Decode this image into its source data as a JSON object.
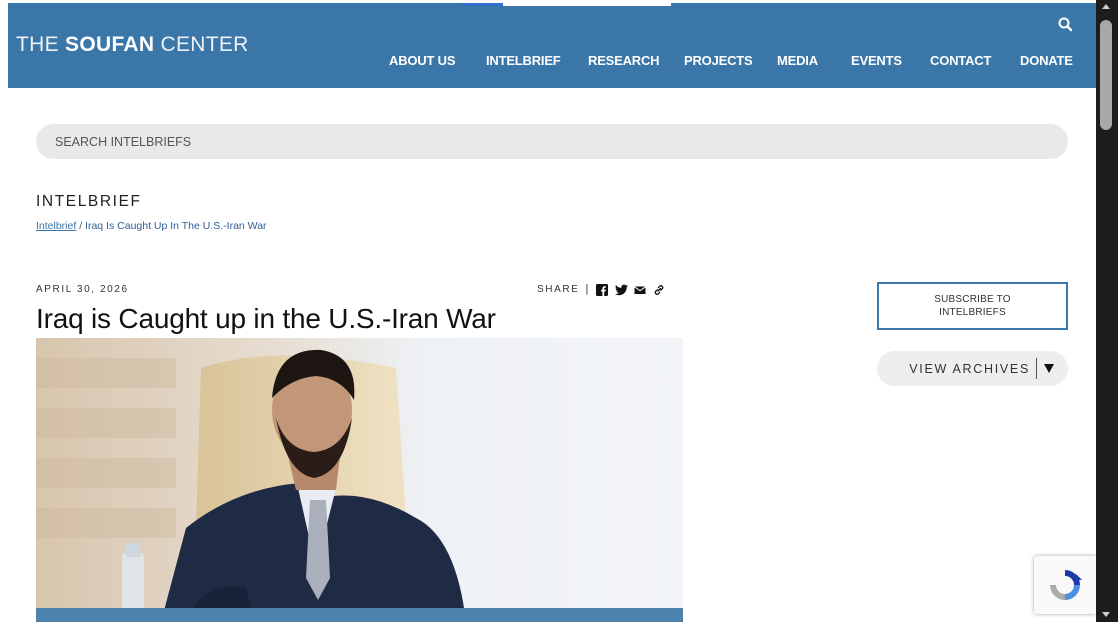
{
  "header": {
    "logo": {
      "part1": "THE ",
      "part2": "SOUFAN",
      "part3": " CENTER"
    },
    "nav": [
      {
        "label": "ABOUT US"
      },
      {
        "label": "INTELBRIEF"
      },
      {
        "label": "RESEARCH"
      },
      {
        "label": "PROJECTS"
      },
      {
        "label": "MEDIA"
      },
      {
        "label": "EVENTS"
      },
      {
        "label": "CONTACT"
      },
      {
        "label": "DONATE"
      }
    ],
    "search_icon": "search-icon"
  },
  "search": {
    "placeholder": "SEARCH INTELBRIEFS"
  },
  "section": {
    "label": "INTELBRIEF",
    "breadcrumb": {
      "link": "Intelbrief",
      "separator": " / ",
      "current": "Iraq Is Caught Up In The U.S.-Iran War"
    }
  },
  "article": {
    "date": "APRIL 30, 2026",
    "share_label": "SHARE",
    "share_separator": "|",
    "share_icons": [
      "facebook-icon",
      "twitter-icon",
      "email-icon",
      "link-icon"
    ],
    "title": "Iraq is Caught up in the U.S.-Iran War"
  },
  "sidebar": {
    "subscribe_label": "SUBSCRIBE TO INTELBRIEFS",
    "archives_label": "VIEW ARCHIVES"
  },
  "colors": {
    "brand_blue": "#3a76a8",
    "text_dark": "#111111",
    "pill_bg": "#e9e9e9"
  }
}
